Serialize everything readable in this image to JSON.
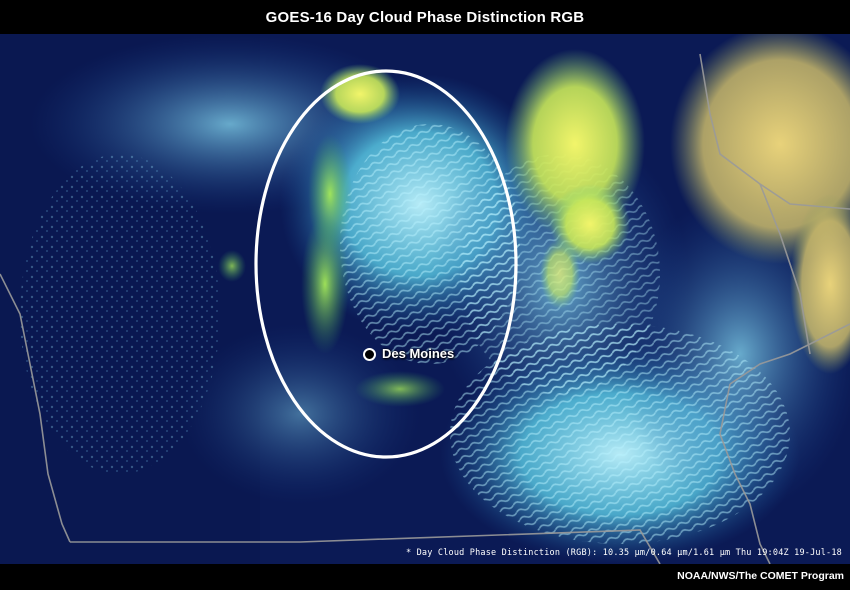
{
  "title": "GOES-16 Day Cloud Phase Distinction RGB",
  "map": {
    "city_label": "Des Moines",
    "product_caption": "* Day Cloud Phase Distinction (RGB): 10.35 µm/0.64 µm/1.61 µm Thu 19:04Z 19-Jul-18",
    "highlight": "ellipse around Des Moines area"
  },
  "credit": "NOAA/NWS/The COMET Program",
  "colors": {
    "background": "#000000",
    "ocean_land_dark": "#0a1a52",
    "cloud_cyan": "#7fe8ff",
    "cloud_green": "#8fe05a",
    "cloud_yellow": "#e6f050",
    "border_gray": "#9a9a9a",
    "ellipse": "#ffffff"
  }
}
